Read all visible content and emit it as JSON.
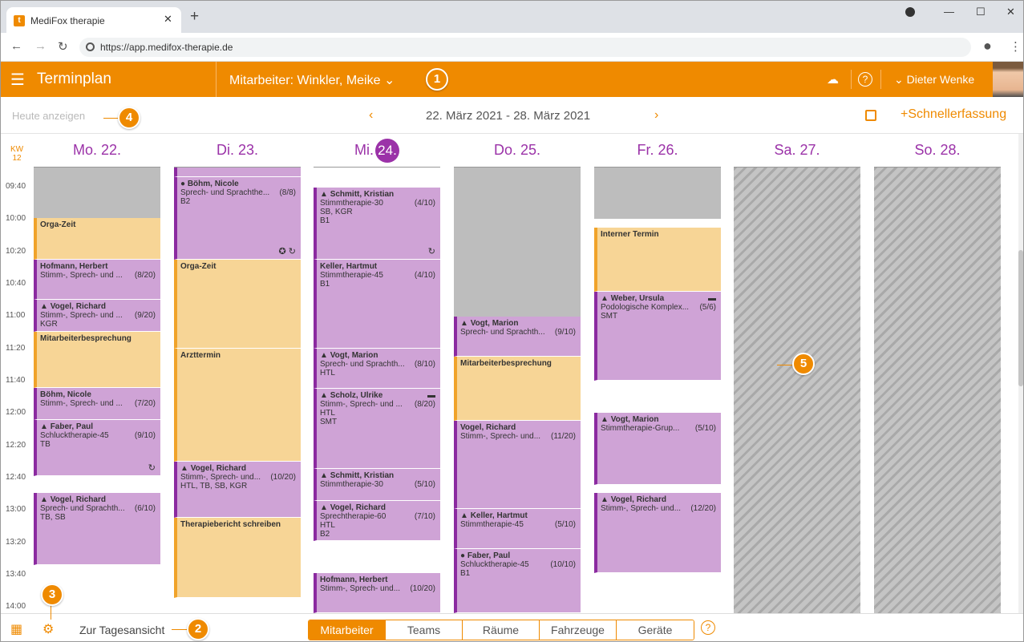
{
  "browser": {
    "tab_title": "MediFox therapie",
    "url": "https://app.medifox-therapie.de",
    "favicon_letter": "t"
  },
  "header": {
    "title": "Terminplan",
    "employee_label": "Mitarbeiter: Winkler, Meike",
    "user_name": "Dieter Wenke"
  },
  "toolbar": {
    "today_label": "Heute anzeigen",
    "date_range": "22. März 2021 - 28. März 2021",
    "quick_entry": "Schnellerfassung"
  },
  "calendar": {
    "kw_label": "KW",
    "kw_number": "12",
    "days": [
      {
        "name": "Mo. 22."
      },
      {
        "name": "Di. 23."
      },
      {
        "name": "Mi.",
        "num": "24."
      },
      {
        "name": "Do. 25."
      },
      {
        "name": "Fr. 26."
      },
      {
        "name": "Sa. 27."
      },
      {
        "name": "So. 28."
      }
    ],
    "times": [
      "09:40",
      "10:00",
      "10:20",
      "10:40",
      "11:00",
      "11:20",
      "11:40",
      "12:00",
      "12:20",
      "12:40",
      "13:00",
      "13:20",
      "13:40",
      "14:00"
    ],
    "events": {
      "mon": [
        {
          "title": "Orga-Zeit"
        },
        {
          "title": "Hofmann, Herbert",
          "line1": "Stimm-, Sprech- und ...",
          "count": "(8/20)"
        },
        {
          "title": "Vogel, Richard",
          "line1": "Stimm-, Sprech- und ...",
          "count": "(9/20)",
          "line2": "KGR"
        },
        {
          "title": "Mitarbeiterbesprechung"
        },
        {
          "title": "Böhm, Nicole",
          "line1": "Stimm-, Sprech- und ...",
          "count": "(7/20)"
        },
        {
          "title": "Faber, Paul",
          "line1": "Schlucktherapie-45",
          "count": "(9/10)",
          "line2": "TB"
        },
        {
          "title": "Vogel, Richard",
          "line1": "Sprech- und Sprachth...",
          "count": "(6/10)",
          "line2": "TB, SB"
        }
      ],
      "tue": [
        {
          "title": "Böhm, Nicole",
          "line1": "Sprech- und Sprachthe...",
          "count": "(8/8)",
          "line2": "B2"
        },
        {
          "title": "Orga-Zeit"
        },
        {
          "title": "Arzttermin"
        },
        {
          "title": "Vogel, Richard",
          "line1": "Stimm-, Sprech- und...",
          "count": "(10/20)",
          "line2": "HTL, TB, SB, KGR"
        },
        {
          "title": "Therapiebericht schreiben"
        }
      ],
      "wed": [
        {
          "title": "Schmitt, Kristian",
          "line1": "Stimmtherapie-30",
          "count": "(4/10)",
          "line2": "SB, KGR",
          "line3": "B1"
        },
        {
          "title": "Keller, Hartmut",
          "line1": "Stimmtherapie-45",
          "count": "(4/10)",
          "line2": "B1"
        },
        {
          "title": "Vogt, Marion",
          "line1": "Sprech- und Sprachth...",
          "count": "(8/10)",
          "line2": "HTL"
        },
        {
          "title": "Scholz, Ulrike",
          "line1": "Stimm-, Sprech- und ...",
          "count": "(8/20)",
          "line2": "HTL",
          "line3": "SMT"
        },
        {
          "title": "Schmitt, Kristian",
          "line1": "Stimmtherapie-30",
          "count": "(5/10)"
        },
        {
          "title": "Vogel, Richard",
          "line1": "Sprechtherapie-60",
          "count": "(7/10)",
          "line2": "HTL",
          "line3": "B2"
        },
        {
          "title": "Hofmann, Herbert",
          "line1": "Stimm-, Sprech- und...",
          "count": "(10/20)"
        }
      ],
      "thu": [
        {
          "title": "Vogt, Marion",
          "line1": "Sprech- und Sprachth...",
          "count": "(9/10)"
        },
        {
          "title": "Mitarbeiterbesprechung"
        },
        {
          "title": "Vogel, Richard",
          "line1": "Stimm-, Sprech- und...",
          "count": "(11/20)"
        },
        {
          "title": "Keller, Hartmut",
          "line1": "Stimmtherapie-45",
          "count": "(5/10)"
        },
        {
          "title": "Faber, Paul",
          "line1": "Schlucktherapie-45",
          "count": "(10/10)",
          "line2": "B1"
        }
      ],
      "fri": [
        {
          "title": "Interner Termin"
        },
        {
          "title": "Weber, Ursula",
          "line1": "Podologische Komplex...",
          "count": "(5/6)",
          "line2": "SMT"
        },
        {
          "title": "Vogt, Marion",
          "line1": "Stimmtherapie-Grup...",
          "count": "(5/10)"
        },
        {
          "title": "Vogel, Richard",
          "line1": "Stimm-, Sprech- und...",
          "count": "(12/20)"
        }
      ]
    }
  },
  "footer": {
    "day_view_label": "Zur Tagesansicht",
    "segments": [
      "Mitarbeiter",
      "Teams",
      "Räume",
      "Fahrzeuge",
      "Geräte"
    ],
    "active_segment": "Mitarbeiter"
  },
  "callouts": [
    "1",
    "2",
    "3",
    "4",
    "5"
  ],
  "colors": {
    "accent": "#ef8a00",
    "purple": "#9b32a8",
    "appointment": "#cfa3d6",
    "internal": "#f7d596"
  }
}
